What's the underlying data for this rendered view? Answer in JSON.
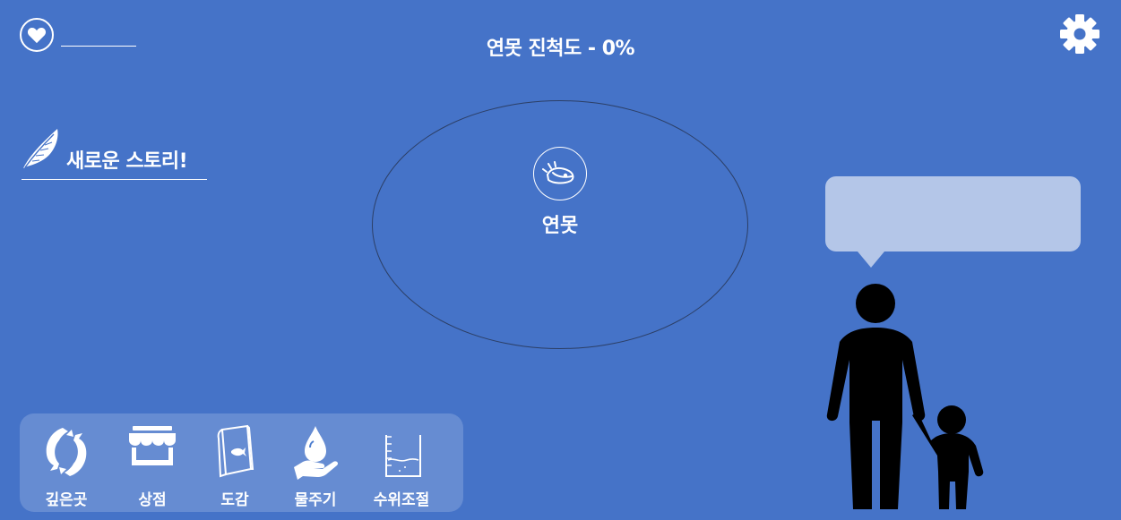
{
  "header": {
    "progress_title": "연못 진척도 - 0%",
    "heart_icon": "heart-icon",
    "settings_icon": "gear-icon"
  },
  "story": {
    "label": "새로운 스토리!",
    "icon": "feather-icon"
  },
  "pond": {
    "label": "연못",
    "icon": "pond-fish-icon"
  },
  "speech_bubble": {
    "text": "",
    "color": "#b4c6e8"
  },
  "menu": {
    "items": [
      {
        "label": "깊은곳",
        "icon": "koi-fish-icon"
      },
      {
        "label": "상점",
        "icon": "shop-icon"
      },
      {
        "label": "도감",
        "icon": "book-icon"
      },
      {
        "label": "물주기",
        "icon": "water-drop-hand-icon"
      },
      {
        "label": "수위조절",
        "icon": "water-level-beaker-icon"
      }
    ]
  },
  "colors": {
    "background": "#4573c8",
    "foreground": "#ffffff",
    "silhouette": "#000000"
  }
}
